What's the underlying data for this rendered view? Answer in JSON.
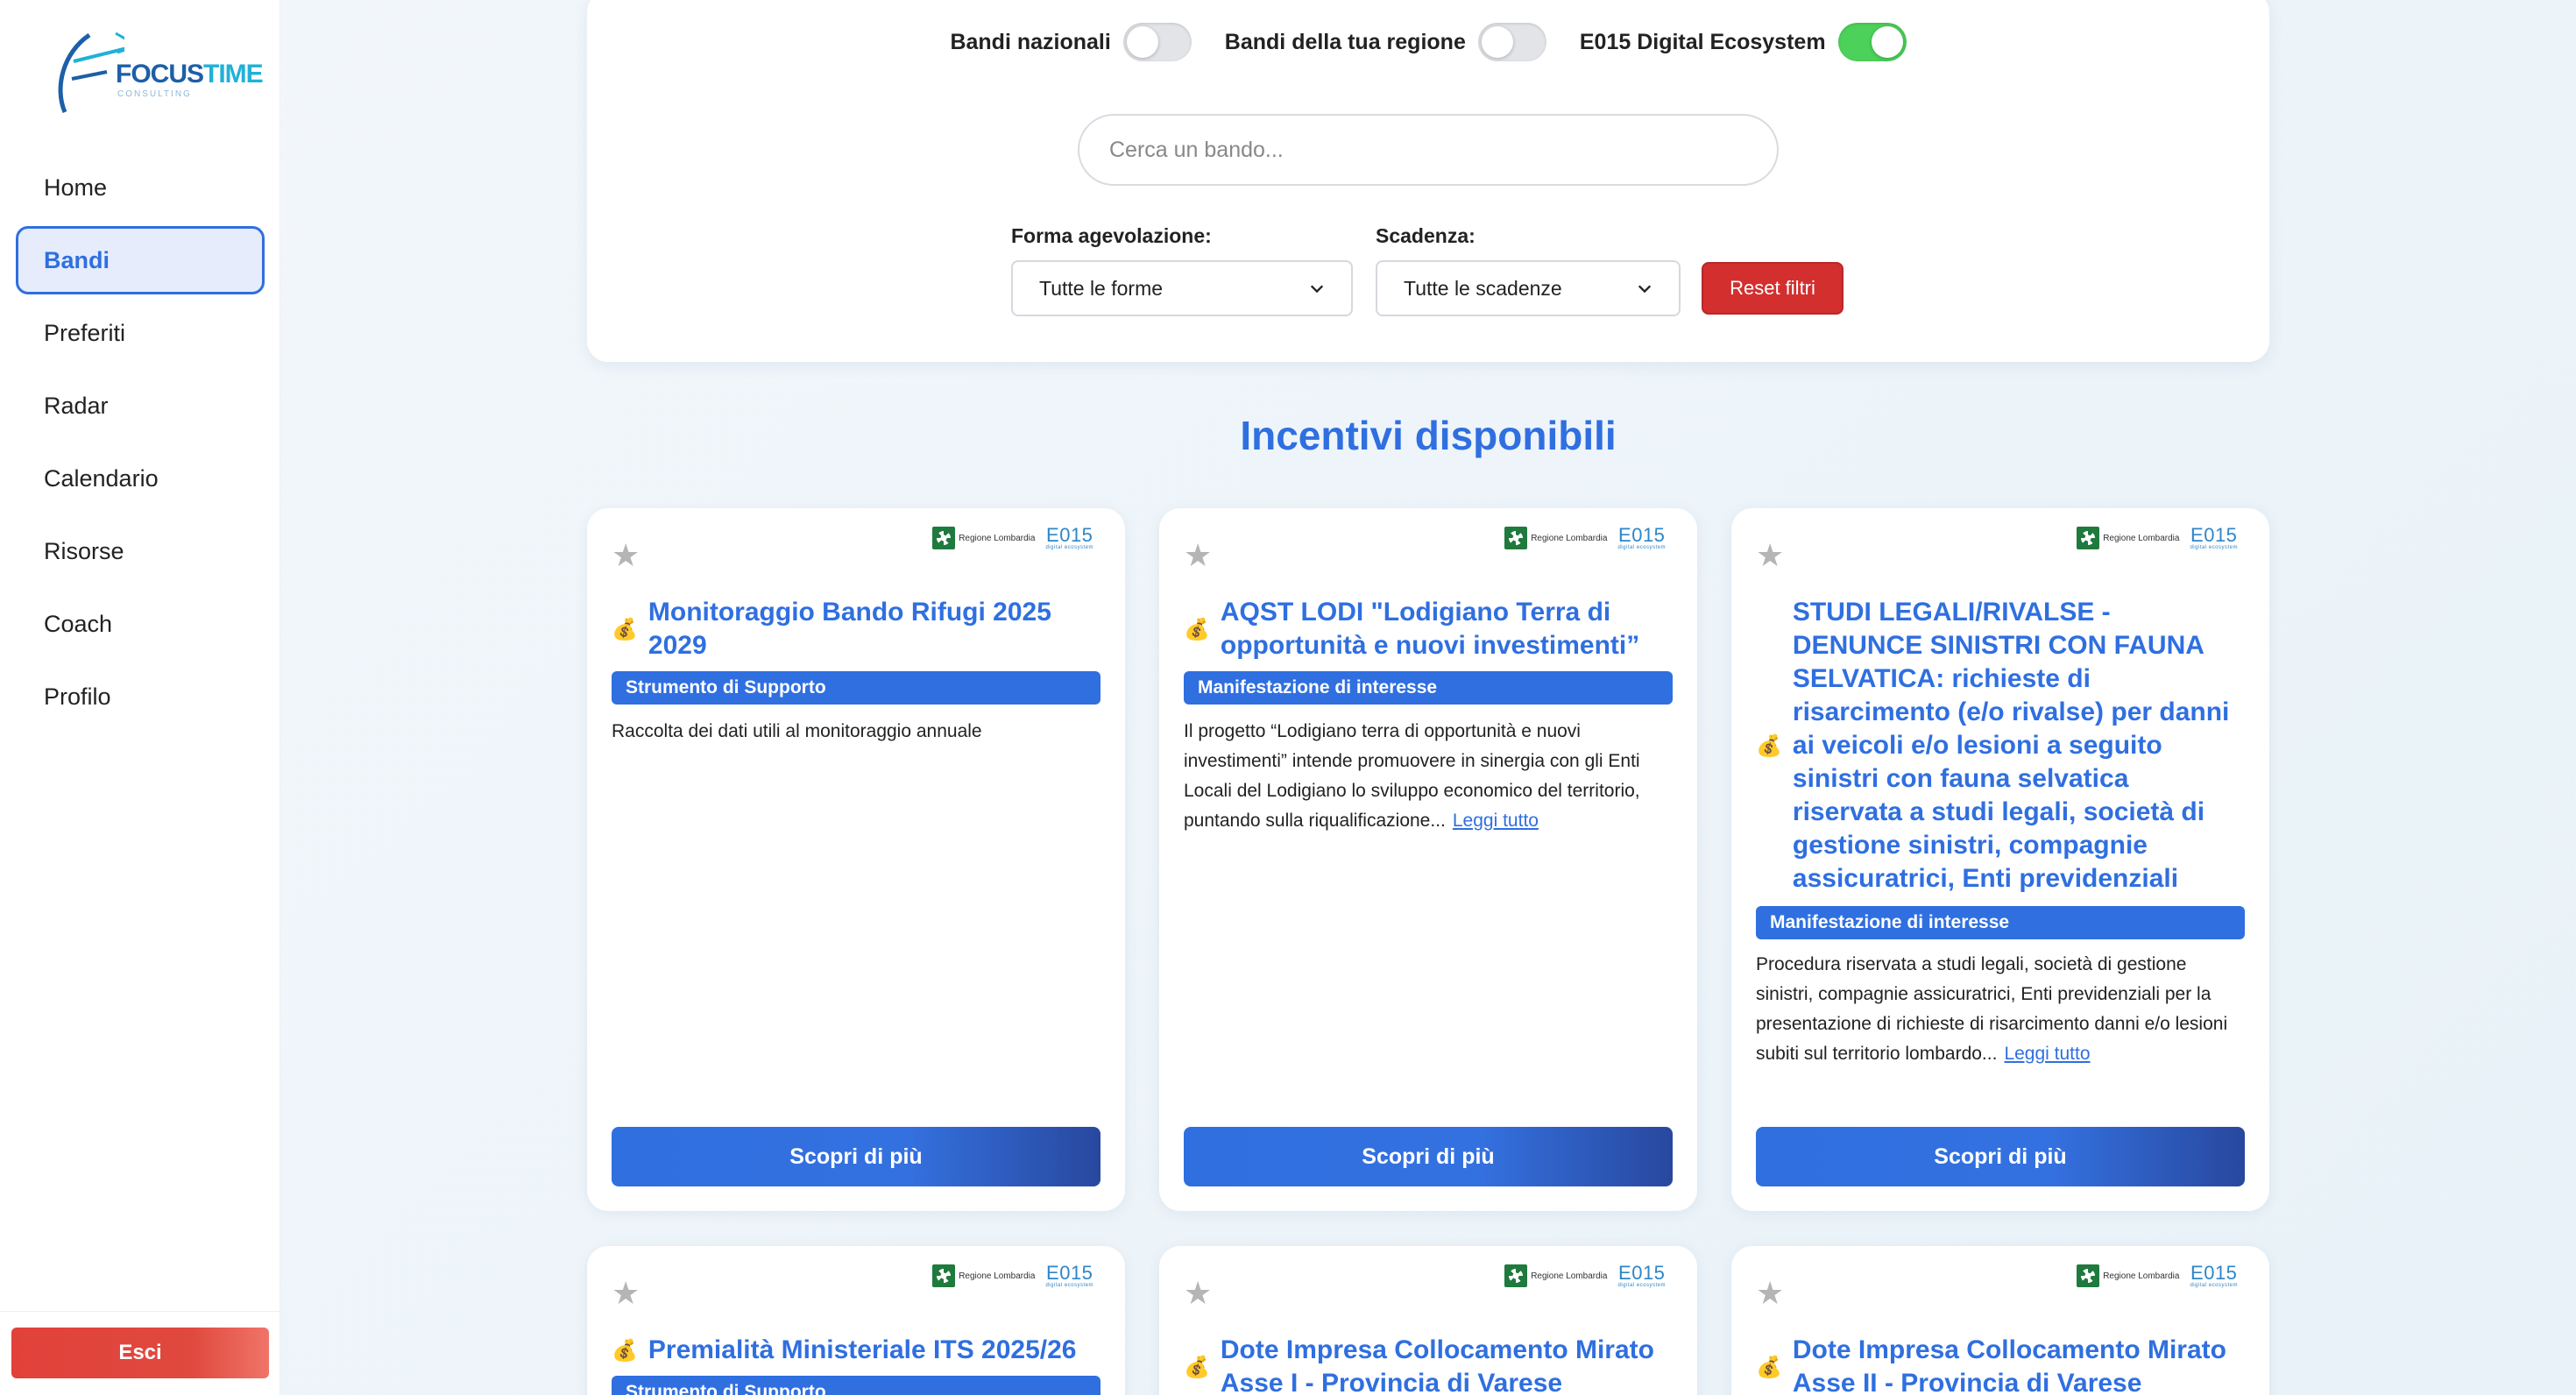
{
  "sidebar": {
    "logo": {
      "brand_a": "FOCUS",
      "brand_b": "TIME",
      "tagline": "CONSULTING"
    },
    "items": [
      {
        "label": "Home"
      },
      {
        "label": "Bandi"
      },
      {
        "label": "Preferiti"
      },
      {
        "label": "Radar"
      },
      {
        "label": "Calendario"
      },
      {
        "label": "Risorse"
      },
      {
        "label": "Coach"
      },
      {
        "label": "Profilo"
      }
    ],
    "logout_label": "Esci"
  },
  "filters": {
    "toggles": [
      {
        "label": "Bandi nazionali",
        "on": false
      },
      {
        "label": "Bandi della tua regione",
        "on": false
      },
      {
        "label": "E015 Digital Ecosystem",
        "on": true
      }
    ],
    "search_placeholder": "Cerca un bando...",
    "forma_label": "Forma agevolazione:",
    "forma_value": "Tutte le forme",
    "scadenza_label": "Scadenza:",
    "scadenza_value": "Tutte le scadenze",
    "reset_label": "Reset filtri"
  },
  "section_title": "Incentivi disponibili",
  "badges": {
    "region": "Regione Lombardia",
    "e015": "E015",
    "e015_sub": "digital ecosystem"
  },
  "cta_label": "Scopri di più",
  "read_more_label": "Leggi tutto",
  "cards": [
    {
      "title": "Monitoraggio Bando Rifugi 2025 2029",
      "tag": "Strumento di Supporto",
      "description": "Raccolta dei dati utili al monitoraggio annuale",
      "has_read_more": false
    },
    {
      "title": "AQST LODI \"Lodigiano Terra di opportunità e nuovi investimenti”",
      "tag": "Manifestazione di interesse",
      "description": "Il progetto “Lodigiano terra di opportunità e nuovi investimenti” intende promuovere in sinergia con gli Enti Locali del Lodigiano lo sviluppo economico del territorio, puntando sulla riqualificazione...",
      "has_read_more": true
    },
    {
      "title": "STUDI LEGALI/RIVALSE - DENUNCE SINISTRI CON FAUNA SELVATICA: richieste di risarcimento (e/o rivalse) per danni ai veicoli e/o lesioni a seguito sinistri con fauna selvatica riservata a studi legali, società di gestione sinistri, compagnie assicuratrici, Enti previdenziali",
      "tag": "Manifestazione di interesse",
      "description": "Procedura riservata a studi legali, società di gestione sinistri, compagnie assicuratrici, Enti previdenziali per la presentazione di richieste di risarcimento danni e/o lesioni subiti sul territorio lombardo...",
      "has_read_more": true
    },
    {
      "title": "Premialità Ministeriale ITS 2025/26",
      "tag": "Strumento di Supporto"
    },
    {
      "title": "Dote Impresa Collocamento Mirato Asse I - Provincia di Varese"
    },
    {
      "title": "Dote Impresa Collocamento Mirato Asse II - Provincia di Varese"
    }
  ]
}
